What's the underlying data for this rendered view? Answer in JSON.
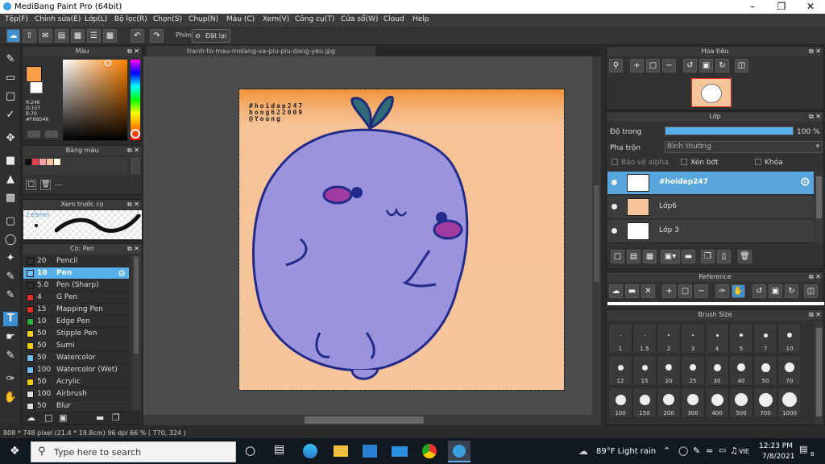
{
  "app": {
    "title": "MediBang Paint Pro (64bit)"
  },
  "menu": [
    "Tệp(F)",
    "Chỉnh sửa(E)",
    "Lớp(L)",
    "Bộ lọc(R)",
    "Chọn(S)",
    "Chụp(N)",
    "Màu (C)",
    "Xem(V)",
    "Công cụ(T)",
    "Cửa sổ(W)",
    "Cloud",
    "Help"
  ],
  "toolbar": {
    "shortcut_label": "Phím",
    "reset_label": "Đặt lại"
  },
  "color_panel": {
    "title": "Màu",
    "r": "R:246",
    "g": "G:157",
    "b": "B:70",
    "hex": "#F69D46",
    "primary": "#f69d46",
    "secondary": "#ffffff"
  },
  "palette_panel": {
    "title": "Bảng màu",
    "swatches": [
      "#111111",
      "#e04050",
      "#f3a0a6",
      "#f6c59b",
      "#fffde0"
    ],
    "dash": "---"
  },
  "brush_preview": {
    "title": "Xem trước cọ",
    "size": "2.65mm"
  },
  "brush_panel": {
    "title": "Cọ: Pen",
    "items": [
      {
        "size": "20",
        "name": "Pencil",
        "color": "#2e2e2e"
      },
      {
        "size": "10",
        "name": "Pen",
        "color": "#6ec0f5",
        "selected": true
      },
      {
        "size": "5.0",
        "name": "Pen (Sharp)",
        "color": "#2e2e2e"
      },
      {
        "size": "4",
        "name": "G Pen",
        "color": "#e03030"
      },
      {
        "size": "15",
        "name": "Mapping Pen",
        "color": "#e03030"
      },
      {
        "size": "10",
        "name": "Edge Pen",
        "color": "#30b040"
      },
      {
        "size": "50",
        "name": "Stipple Pen",
        "color": "#f0d000"
      },
      {
        "size": "50",
        "name": "Sumi",
        "color": "#f0d000"
      },
      {
        "size": "50",
        "name": "Watercolor",
        "color": "#6ec0f5"
      },
      {
        "size": "100",
        "name": "Watercolor (Wet)",
        "color": "#6ec0f5"
      },
      {
        "size": "50",
        "name": "Acrylic",
        "color": "#f0d000"
      },
      {
        "size": "100",
        "name": "Airbrush",
        "color": "#dddddd"
      },
      {
        "size": "50",
        "name": "Blur",
        "color": "#dddddd"
      }
    ]
  },
  "document": {
    "tab": "tranh-to-mau-molang-va-piu-piu-dang-yeu.jpg",
    "watermark": [
      "#hoidap247",
      "hong622009",
      "@Young"
    ]
  },
  "navigator": {
    "title": "Hoa tiêu"
  },
  "layer_panel": {
    "title": "Lớp",
    "opacity_label": "Độ trong",
    "opacity_value": "100 %",
    "opacity": 1.0,
    "blend_label": "Pha trộn",
    "blend_value": "Bình thường",
    "protect_alpha": "Bảo vệ alpha",
    "clipping": "Xén bớt",
    "lock": "Khóa",
    "layers": [
      {
        "name": "#hoidap247",
        "selected": true
      },
      {
        "name": "Lớp6",
        "selected": false
      },
      {
        "name": "Lớp 3",
        "selected": false
      }
    ]
  },
  "reference_panel": {
    "title": "Reference"
  },
  "brush_size_panel": {
    "title": "Brush Size",
    "sizes": [
      "1",
      "1.5",
      "2",
      "3",
      "4",
      "5",
      "7",
      "10",
      "12",
      "15",
      "20",
      "25",
      "30",
      "40",
      "50",
      "70",
      "100",
      "150",
      "200",
      "300",
      "400",
      "500",
      "700",
      "1000"
    ]
  },
  "status": {
    "text": "808 * 748 pixel  (21.4 * 19.8cm)  96 dpi  66 %  ( 770, 324 )"
  },
  "taskbar": {
    "search_placeholder": "Type here to search",
    "weather": "89°F  Light rain",
    "lang": "VIE",
    "time": "12:23 PM",
    "date": "7/8/2021",
    "notify_count": "8"
  }
}
